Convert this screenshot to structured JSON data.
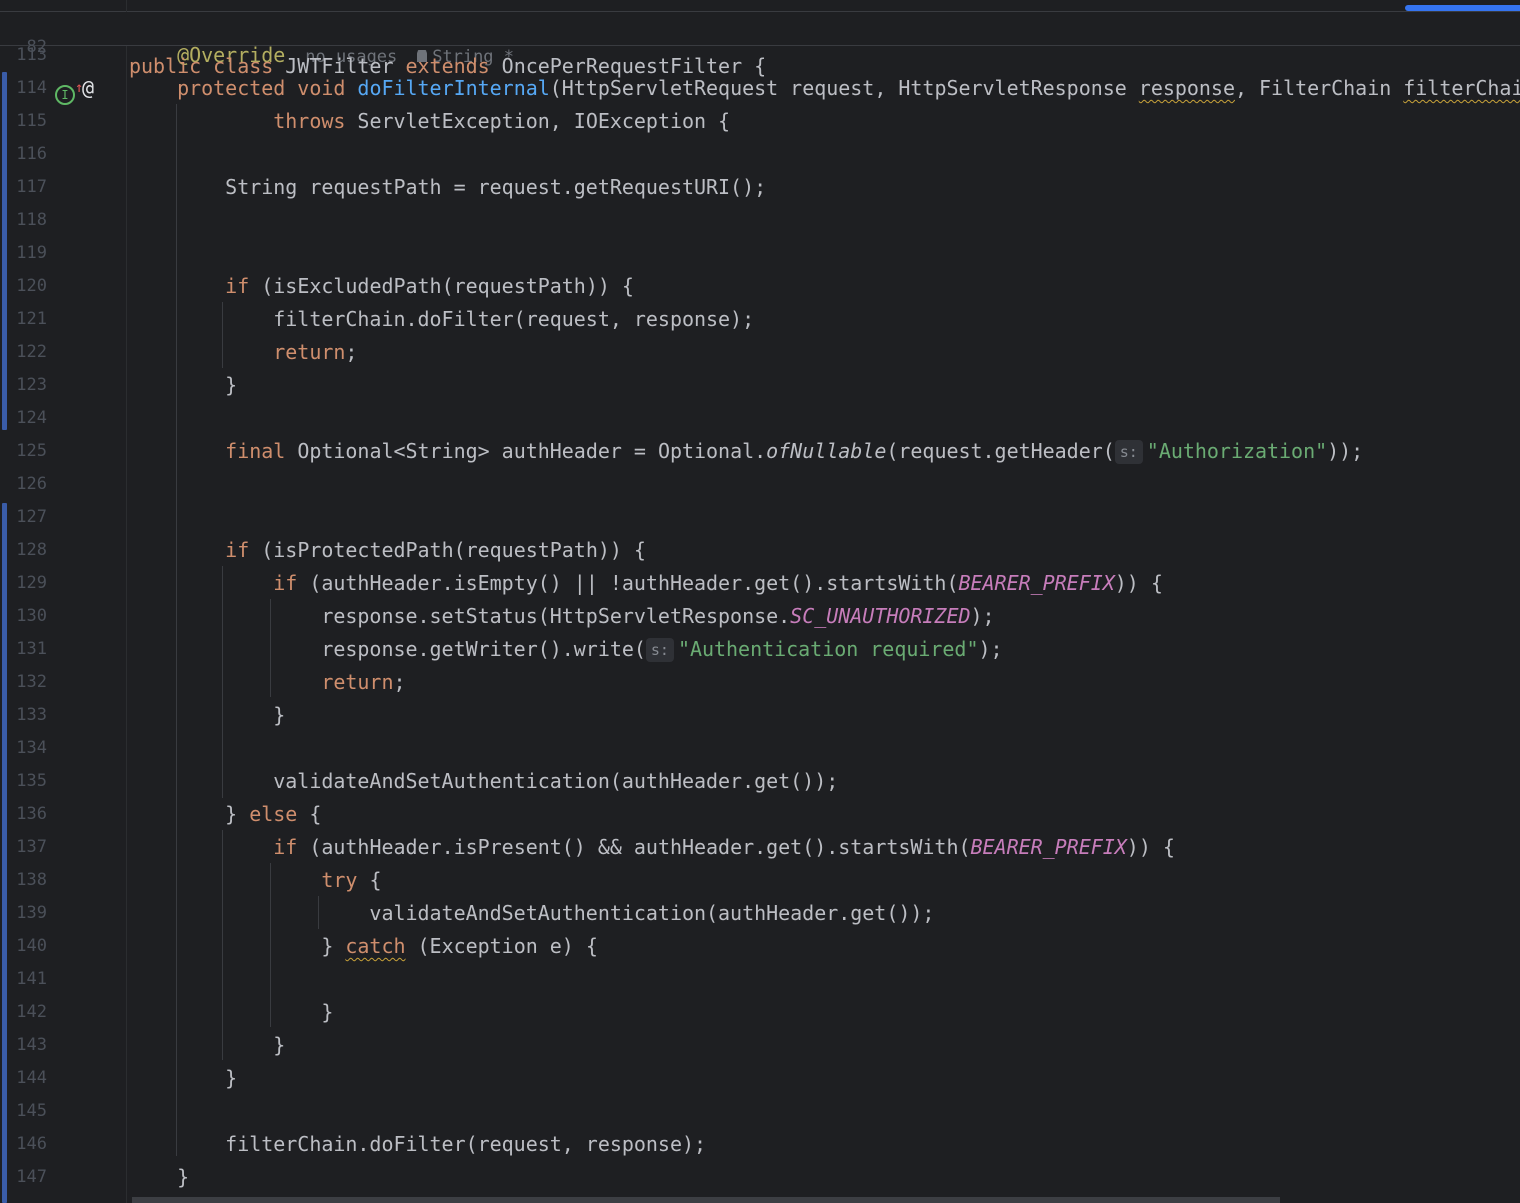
{
  "editor": {
    "sticky_line": {
      "n": "82",
      "tokens": [
        [
          "kw",
          "public class "
        ],
        [
          "",
          "JWTFilter "
        ],
        [
          "kw",
          "extends "
        ],
        [
          "",
          "OncePerRequestFilter {"
        ]
      ]
    },
    "inlay": {
      "usages": "no usages",
      "author": "String *"
    },
    "gutter_icons": {
      "implements": "I",
      "up_arrow": "↑",
      "override": "@"
    },
    "lines": [
      {
        "n": "113",
        "tokens": [
          [
            "",
            "    "
          ],
          [
            "ann",
            "@Override"
          ]
        ]
      },
      {
        "n": "114",
        "tokens": [
          [
            "",
            "    "
          ],
          [
            "kw",
            "protected void "
          ],
          [
            "fn",
            "doFilterInternal"
          ],
          [
            "",
            "(HttpServletRequest request, HttpServletResponse "
          ],
          [
            "warn",
            "response"
          ],
          [
            "",
            ", FilterChain "
          ],
          [
            "warn",
            "filterChain"
          ],
          [
            "",
            ") "
          ]
        ]
      },
      {
        "n": "115",
        "tokens": [
          [
            "",
            "            "
          ],
          [
            "kw",
            "throws "
          ],
          [
            "",
            "ServletException, IOException {"
          ]
        ]
      },
      {
        "n": "116",
        "tokens": []
      },
      {
        "n": "117",
        "tokens": [
          [
            "",
            "        String requestPath = request.getRequestURI();"
          ]
        ]
      },
      {
        "n": "118",
        "tokens": []
      },
      {
        "n": "119",
        "tokens": []
      },
      {
        "n": "120",
        "tokens": [
          [
            "",
            "        "
          ],
          [
            "kw",
            "if "
          ],
          [
            "",
            "(isExcludedPath(requestPath)) {"
          ]
        ]
      },
      {
        "n": "121",
        "tokens": [
          [
            "",
            "            filterChain.doFilter(request, response);"
          ]
        ]
      },
      {
        "n": "122",
        "tokens": [
          [
            "",
            "            "
          ],
          [
            "kw",
            "return"
          ],
          [
            "",
            ";"
          ]
        ]
      },
      {
        "n": "123",
        "tokens": [
          [
            "",
            "        }"
          ]
        ]
      },
      {
        "n": "124",
        "tokens": []
      },
      {
        "n": "125",
        "tokens": [
          [
            "",
            "        "
          ],
          [
            "kw",
            "final "
          ],
          [
            "",
            "Optional<String> authHeader = Optional."
          ],
          [
            "ital",
            "ofNullable"
          ],
          [
            "",
            "(request.getHeader("
          ],
          [
            "hint",
            "s:"
          ],
          [
            "str",
            "\"Authorization\""
          ],
          [
            "",
            "));"
          ]
        ]
      },
      {
        "n": "126",
        "tokens": []
      },
      {
        "n": "127",
        "tokens": []
      },
      {
        "n": "128",
        "tokens": [
          [
            "",
            "        "
          ],
          [
            "kw",
            "if "
          ],
          [
            "",
            "(isProtectedPath(requestPath)) {"
          ]
        ]
      },
      {
        "n": "129",
        "tokens": [
          [
            "",
            "            "
          ],
          [
            "kw",
            "if "
          ],
          [
            "",
            "(authHeader.isEmpty() || !authHeader.get().startsWith("
          ],
          [
            "const",
            "BEARER_PREFIX"
          ],
          [
            "",
            ")) {"
          ]
        ]
      },
      {
        "n": "130",
        "tokens": [
          [
            "",
            "                response.setStatus(HttpServletResponse."
          ],
          [
            "const",
            "SC_UNAUTHORIZED"
          ],
          [
            "",
            ");"
          ]
        ]
      },
      {
        "n": "131",
        "tokens": [
          [
            "",
            "                response.getWriter().write("
          ],
          [
            "hint",
            "s:"
          ],
          [
            "str",
            "\"Authentication required\""
          ],
          [
            "",
            ");"
          ]
        ]
      },
      {
        "n": "132",
        "tokens": [
          [
            "",
            "                "
          ],
          [
            "kw",
            "return"
          ],
          [
            "",
            ";"
          ]
        ]
      },
      {
        "n": "133",
        "tokens": [
          [
            "",
            "            }"
          ]
        ]
      },
      {
        "n": "134",
        "tokens": []
      },
      {
        "n": "135",
        "tokens": [
          [
            "",
            "            validateAndSetAuthentication(authHeader.get());"
          ]
        ]
      },
      {
        "n": "136",
        "tokens": [
          [
            "",
            "        } "
          ],
          [
            "kw",
            "else "
          ],
          [
            "",
            "{"
          ]
        ]
      },
      {
        "n": "137",
        "tokens": [
          [
            "",
            "            "
          ],
          [
            "kw",
            "if "
          ],
          [
            "",
            "(authHeader.isPresent() && authHeader.get().startsWith("
          ],
          [
            "const",
            "BEARER_PREFIX"
          ],
          [
            "",
            ")) {"
          ]
        ]
      },
      {
        "n": "138",
        "tokens": [
          [
            "",
            "                "
          ],
          [
            "kw",
            "try "
          ],
          [
            "",
            "{"
          ]
        ]
      },
      {
        "n": "139",
        "tokens": [
          [
            "",
            "                    validateAndSetAuthentication(authHeader.get());"
          ]
        ]
      },
      {
        "n": "140",
        "tokens": [
          [
            "",
            "                } "
          ],
          [
            "kw warn",
            "catch"
          ],
          [
            "",
            " (Exception e) {"
          ]
        ]
      },
      {
        "n": "141",
        "tokens": []
      },
      {
        "n": "142",
        "tokens": [
          [
            "",
            "                }"
          ]
        ]
      },
      {
        "n": "143",
        "tokens": [
          [
            "",
            "            }"
          ]
        ]
      },
      {
        "n": "144",
        "tokens": [
          [
            "",
            "        }"
          ]
        ]
      },
      {
        "n": "145",
        "tokens": []
      },
      {
        "n": "146",
        "tokens": [
          [
            "",
            "        filterChain.doFilter(request, response);"
          ]
        ]
      },
      {
        "n": "147",
        "tokens": [
          [
            "",
            "    }"
          ]
        ]
      }
    ]
  }
}
